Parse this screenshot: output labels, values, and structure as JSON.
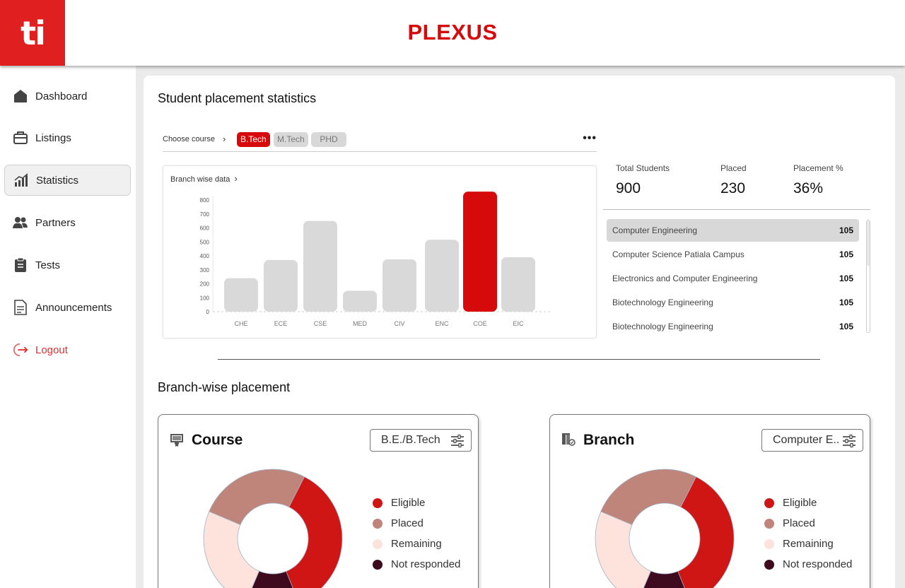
{
  "app": {
    "logo": "ti",
    "title": "PLEXUS"
  },
  "sidebar": {
    "items": [
      {
        "label": "Dashboard",
        "icon": "home-icon"
      },
      {
        "label": "Listings",
        "icon": "briefcase-icon"
      },
      {
        "label": "Statistics",
        "icon": "bar-chart-icon",
        "active": true
      },
      {
        "label": "Partners",
        "icon": "users-icon"
      },
      {
        "label": "Tests",
        "icon": "clipboard-icon"
      },
      {
        "label": "Announcements",
        "icon": "document-icon"
      },
      {
        "label": "Logout",
        "icon": "logout-icon"
      }
    ]
  },
  "stats_section": {
    "title": "Student placement statistics",
    "choose_label": "Choose course",
    "courses": [
      "B.Tech",
      "M.Tech",
      "PHD"
    ],
    "active_course": "B.Tech",
    "chart_title": "Branch wise data",
    "summary": [
      {
        "label": "Total Students",
        "value": "900"
      },
      {
        "label": "Placed",
        "value": "230"
      },
      {
        "label": "Placement %",
        "value": "36%"
      }
    ],
    "branches": [
      {
        "name": "Computer Engineering",
        "count": "105"
      },
      {
        "name": "Computer Science Patiala Campus",
        "count": "105"
      },
      {
        "name": "Electronics and Computer Engineering",
        "count": "105"
      },
      {
        "name": "Biotechnology Engineering",
        "count": "105"
      },
      {
        "name": "Biotechnology Engineering",
        "count": "105"
      }
    ]
  },
  "chart_data": {
    "type": "bar",
    "categories": [
      "CHE",
      "ECE",
      "CSE",
      "MED",
      "CIV",
      "ENC",
      "COE",
      "EIC"
    ],
    "values": [
      240,
      370,
      650,
      150,
      375,
      515,
      900,
      390
    ],
    "highlight": "COE",
    "highlight_color": "#d60a0a",
    "bar_color": "#d9d9d9",
    "yticks": [
      0,
      100,
      200,
      300,
      400,
      500,
      600,
      700,
      800
    ],
    "ylim": [
      0,
      800
    ]
  },
  "branch_section": {
    "title": "Branch-wise placement",
    "legend": [
      {
        "label": "Eligible",
        "color": "#d01515"
      },
      {
        "label": "Placed",
        "color": "#bf857a"
      },
      {
        "label": "Remaining",
        "color": "#fde3db"
      },
      {
        "label": "Not responded",
        "color": "#3d0a1e"
      }
    ],
    "cards": [
      {
        "title": "Course",
        "filter": "B.E./B.Tech",
        "icon": "certificate-icon"
      },
      {
        "title": "Branch",
        "filter": "Computer E..",
        "icon": "branch-icon"
      }
    ]
  }
}
